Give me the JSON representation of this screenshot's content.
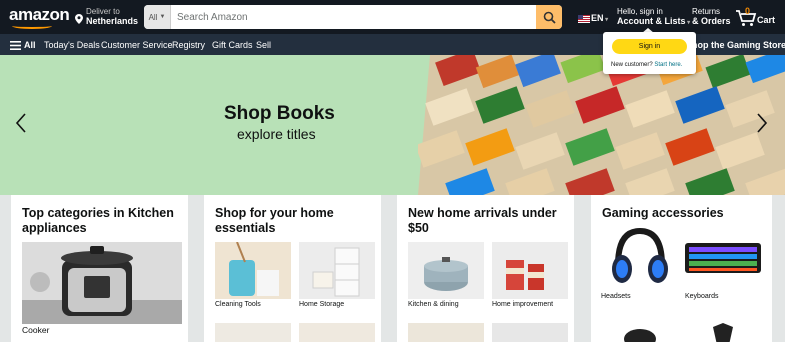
{
  "nav": {
    "logo": "amazon",
    "deliver_small": "Deliver to",
    "deliver_location": "Netherlands",
    "search_category": "All",
    "search_placeholder": "Search Amazon",
    "language": "EN",
    "account_small": "Hello, sign in",
    "account_big": "Account & Lists",
    "returns_small": "Returns",
    "returns_big": "& Orders",
    "cart_count": "0",
    "cart_label": "Cart"
  },
  "subnav": {
    "all": "All",
    "items": [
      "Today's Deals",
      "Customer Service",
      "Registry",
      "Gift Cards",
      "Sell"
    ],
    "right": "hop the Gaming Store"
  },
  "flyout": {
    "signin": "Sign in",
    "new_customer": "New customer?",
    "start_here": "Start here."
  },
  "hero": {
    "title": "Shop Books",
    "subtitle": "explore titles"
  },
  "cards": [
    {
      "title": "Top categories in Kitchen appliances",
      "items": [
        "Cooker"
      ]
    },
    {
      "title": "Shop for your home essentials",
      "items": [
        "Cleaning Tools",
        "Home Storage"
      ]
    },
    {
      "title": "New home arrivals under $50",
      "items": [
        "Kitchen & dining",
        "Home improvement"
      ]
    },
    {
      "title": "Gaming accessories",
      "items": [
        "Headsets",
        "Keyboards"
      ]
    }
  ],
  "colors": {
    "nav_bg": "#131921",
    "subnav_bg": "#232f3e",
    "accent": "#febd69",
    "signin": "#ffd814",
    "hero_bg": "#b8e1b7"
  }
}
